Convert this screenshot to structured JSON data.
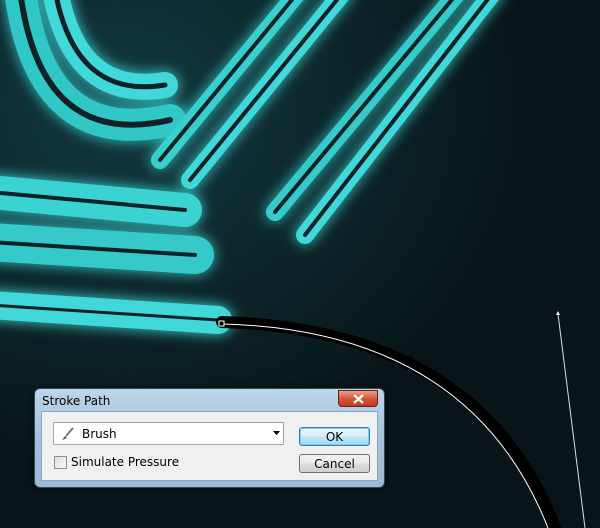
{
  "canvas": {
    "background": "#081417",
    "accent_color": "#3fd8d8",
    "path_color": "#ffffff"
  },
  "dialog": {
    "title": "Stroke Path",
    "close_icon": "close-icon",
    "tool_select": {
      "icon": "brush-icon",
      "value": "Brush"
    },
    "simulate_pressure": {
      "label": "Simulate Pressure",
      "checked": false
    },
    "ok_label": "OK",
    "cancel_label": "Cancel"
  }
}
